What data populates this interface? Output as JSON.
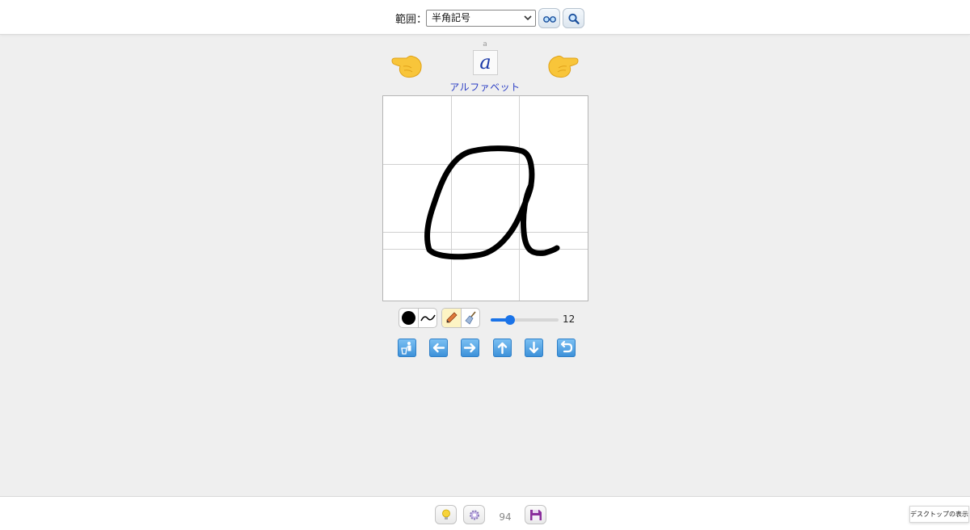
{
  "header": {
    "range_label": "範囲：",
    "range_select": {
      "selected": "半角記号"
    },
    "buttons": [
      {
        "name": "glasses-button",
        "icon": "glasses-icon"
      },
      {
        "name": "search-button",
        "icon": "search-icon"
      }
    ]
  },
  "character": {
    "small_label": "a",
    "glyph": "a",
    "category": "アルファベット",
    "prev_icon": "pointing-left-hand-icon",
    "next_icon": "pointing-right-hand-icon"
  },
  "canvas": {
    "stroke_color": "#000000",
    "grid_color": "#d0d0d0",
    "has_drawing": true
  },
  "tools": {
    "pen_color": "#000000",
    "brush_icon": "curve-stroke-icon",
    "pen_icon": "pencil-icon",
    "eraser_icon": "broom-icon",
    "active_tool": "pencil",
    "size_min": 1,
    "size_max": 40,
    "size_value": "12"
  },
  "nav": [
    {
      "name": "clear-button",
      "icon": "person-trash-icon"
    },
    {
      "name": "shift-left-button",
      "icon": "arrow-left-icon"
    },
    {
      "name": "shift-right-button",
      "icon": "arrow-right-icon"
    },
    {
      "name": "shift-up-button",
      "icon": "arrow-up-icon"
    },
    {
      "name": "shift-down-button",
      "icon": "arrow-down-icon"
    },
    {
      "name": "undo-button",
      "icon": "return-arrow-icon"
    }
  ],
  "footer": {
    "hint_icon": "lightbulb-icon",
    "settings_icon": "gear-icon",
    "count": "94",
    "save_icon": "floppy-disk-icon",
    "tooltip": "デスクトップの表示"
  },
  "colors": {
    "accent": "#1a73e8",
    "category_text": "#2b3ec4",
    "nav_button": "#3a8fd8",
    "background": "#efefef"
  }
}
